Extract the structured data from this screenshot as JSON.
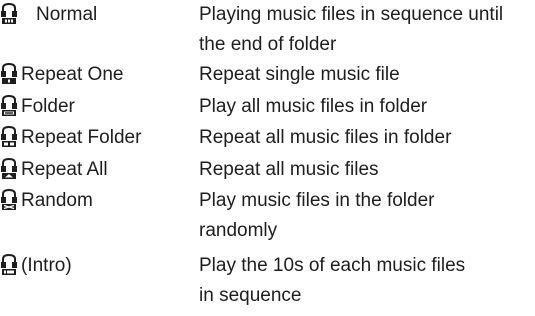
{
  "rows": [
    {
      "mode": "Normal",
      "description": [
        "Playing music files in sequence until",
        "the end of folder"
      ],
      "icon": "repeat-mode-normal-icon"
    },
    {
      "mode": "Repeat One",
      "description": [
        "Repeat single music file"
      ],
      "icon": "repeat-mode-one-icon"
    },
    {
      "mode": "Folder",
      "description": [
        "Play all music files in folder"
      ],
      "icon": "repeat-mode-folder-icon"
    },
    {
      "mode": "Repeat Folder",
      "description": [
        "Repeat all music files in folder"
      ],
      "icon": "repeat-mode-repeat-folder-icon"
    },
    {
      "mode": "Repeat All",
      "description": [
        "Repeat all music files"
      ],
      "icon": "repeat-mode-all-icon"
    },
    {
      "mode": "Random",
      "description": [
        "Play music files in the folder",
        "randomly"
      ],
      "icon": "repeat-mode-random-icon"
    },
    {
      "mode": "(Intro)",
      "description": [
        "Play the 10s of each music files",
        "in sequence"
      ],
      "icon": "repeat-mode-intro-icon"
    }
  ]
}
